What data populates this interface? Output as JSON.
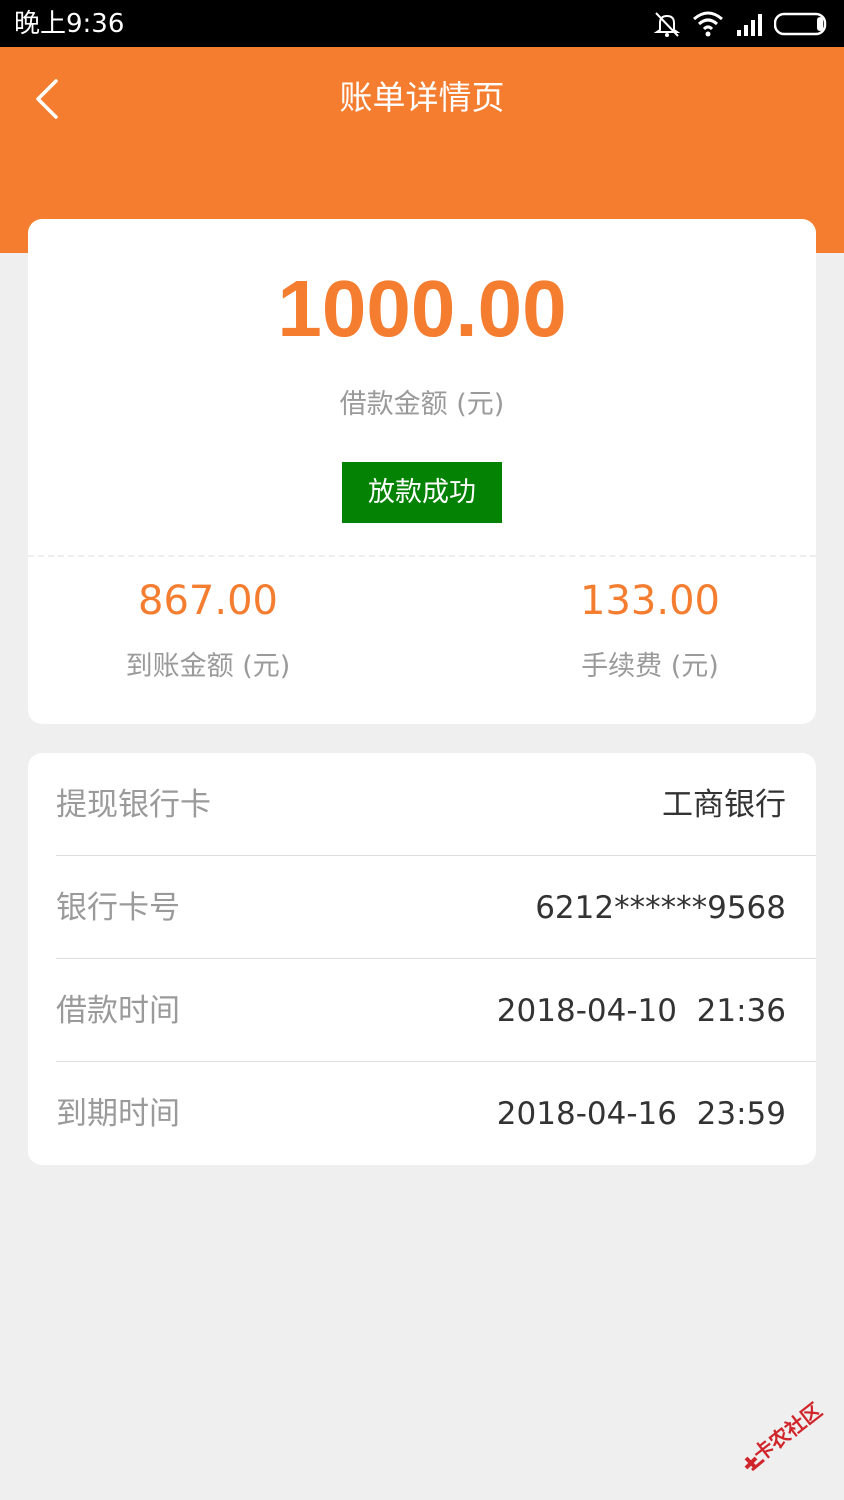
{
  "status_bar": {
    "time": "晚上9:36",
    "icons": [
      "bell-off-icon",
      "wifi-icon",
      "signal-icon",
      "battery-icon"
    ]
  },
  "header": {
    "title": "账单详情页",
    "back_icon": "chevron-left-icon",
    "color": "#f47d30"
  },
  "summary": {
    "loan_amount": "1000.00",
    "loan_amount_label": "借款金额 (元)",
    "status": "放款成功",
    "status_color": "#038203",
    "received_amount": "867.00",
    "received_amount_label": "到账金额 (元)",
    "fee_amount": "133.00",
    "fee_amount_label": "手续费 (元)"
  },
  "details": [
    {
      "label": "提现银行卡",
      "value": "工商银行"
    },
    {
      "label": "银行卡号",
      "value": "6212******9568"
    },
    {
      "label": "借款时间",
      "value": "2018-04-10  21:36"
    },
    {
      "label": "到期时间",
      "value": "2018-04-16  23:59"
    }
  ],
  "watermark": {
    "text": "卡农社区"
  }
}
